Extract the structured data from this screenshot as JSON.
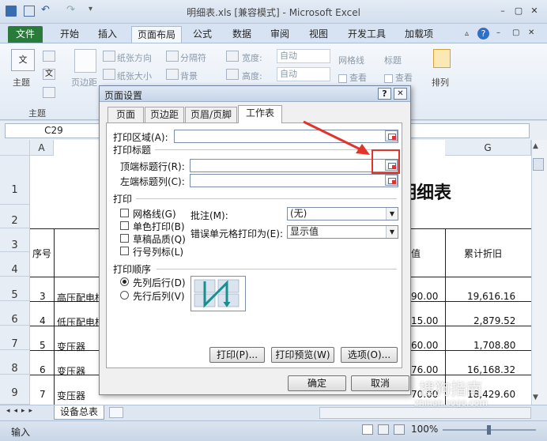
{
  "window": {
    "title": "明细表.xls  [兼容模式] - Microsoft Excel",
    "min": "–",
    "restore": "▢",
    "close": "✕"
  },
  "ribbon_tabs": [
    "文件",
    "开始",
    "插入",
    "页面布局",
    "公式",
    "数据",
    "审阅",
    "视图",
    "开发工具",
    "加载项"
  ],
  "ribbon": {
    "theme_label": "主题",
    "theme_group": "主题",
    "margins_label": "页边距",
    "orientation": "纸张方向",
    "size": "纸张大小",
    "breaks": "分隔符",
    "background": "背景",
    "width_label": "宽度:",
    "width_value": "自动",
    "height_label": "高度:",
    "height_value": "自动",
    "gridlines_label": "网格线",
    "headings_label": "标题",
    "view_label": "查看",
    "arrange_label": "排列"
  },
  "formula_bar": {
    "name_box": "C29"
  },
  "columns": [
    "A",
    "G"
  ],
  "rows": [
    "1",
    "2",
    "3",
    "4",
    "5",
    "6",
    "7",
    "8",
    "9"
  ],
  "sheet": {
    "title_fragment": "明细表",
    "header_seq": "序号",
    "header_value": "值",
    "header_accum": "累计折旧",
    "data": [
      {
        "no": "3",
        "name": "高压配电柜",
        "val": "90.00",
        "accum": "19,616.16"
      },
      {
        "no": "4",
        "name": "低压配电柜",
        "val": "15.00",
        "accum": "2,879.52"
      },
      {
        "no": "5",
        "name": "变压器",
        "val": "60.00",
        "accum": "1,708.80"
      },
      {
        "no": "6",
        "name": "变压器",
        "val": "76.00",
        "accum": "16,168.32"
      },
      {
        "no": "7",
        "name": "变压器",
        "val": "70.00",
        "accum": "18,429.60"
      }
    ]
  },
  "sheet_tabs": {
    "active": "设备总表"
  },
  "status": {
    "mode": "输入",
    "zoom": "100%"
  },
  "watermark": {
    "brand": "搜狗指南",
    "url": "zhinan.sogo.com"
  },
  "dialog": {
    "title": "页面设置",
    "help": "?",
    "close": "✕",
    "tabs": [
      "页面",
      "页边距",
      "页眉/页脚",
      "工作表"
    ],
    "print_area_label": "打印区域(A):",
    "print_titles_label": "打印标题",
    "top_rows_label": "顶端标题行(R):",
    "left_cols_label": "左端标题列(C):",
    "print_section": "打印",
    "gridlines": "网格线(G)",
    "mono": "单色打印(B)",
    "draft": "草稿品质(Q)",
    "rowcol": "行号列标(L)",
    "comments_label": "批注(M):",
    "comments_value": "(无)",
    "errors_label": "错误单元格打印为(E):",
    "errors_value": "显示值",
    "order_section": "打印顺序",
    "down_then_over": "先列后行(D)",
    "over_then_down": "先行后列(V)",
    "print_btn": "打印(P)...",
    "preview_btn": "打印预览(W)",
    "options_btn": "选项(O)...",
    "ok_btn": "确定",
    "cancel_btn": "取消"
  },
  "colors": {
    "file_tab": "#2a7a3a",
    "annotation": "#e2342a"
  }
}
